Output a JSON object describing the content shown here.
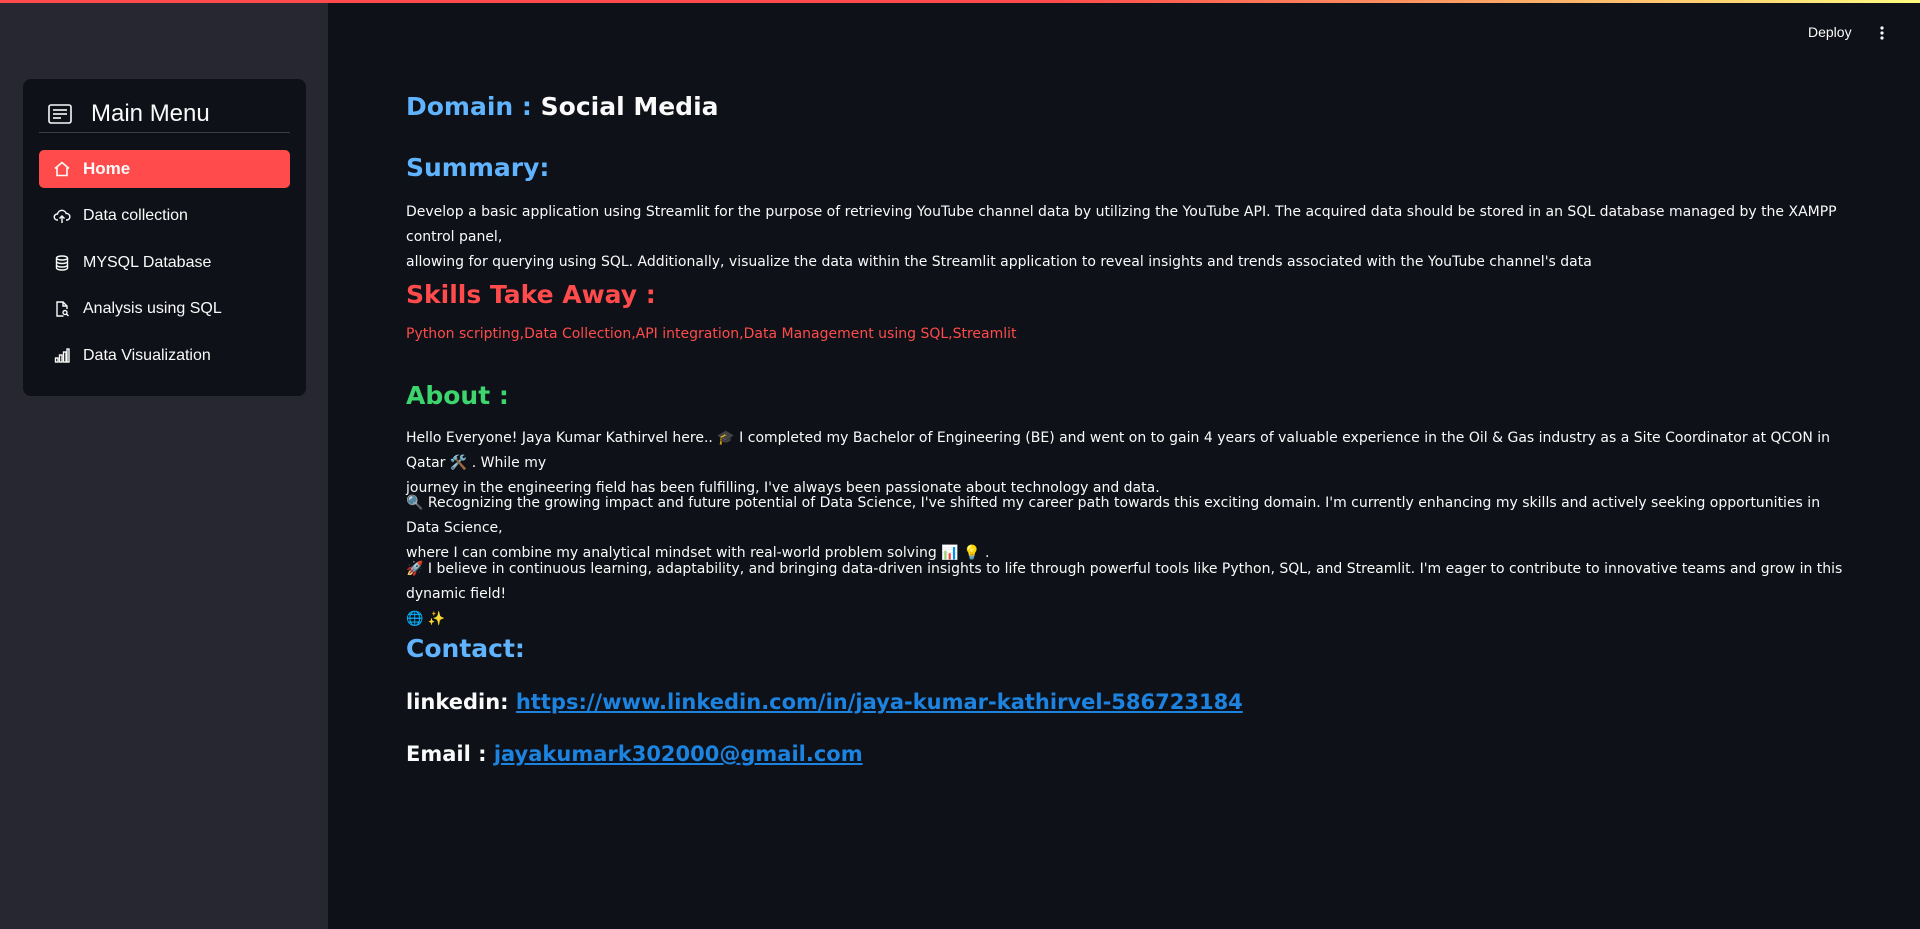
{
  "colors": {
    "accent": "#ff4b4b",
    "heading_blue": "#60b4ff",
    "about_green": "#3dd56d",
    "link": "#1c83e1",
    "background": "#0e1117",
    "sidebar": "#262730"
  },
  "header": {
    "deploy_label": "Deploy",
    "menu_icon": "vertical-dots-icon"
  },
  "sidebar": {
    "title": "Main Menu",
    "title_icon": "menu-card-icon",
    "items": [
      {
        "label": "Home",
        "icon": "home-icon",
        "active": true
      },
      {
        "label": "Data collection",
        "icon": "cloud-upload-icon",
        "active": false
      },
      {
        "label": "MYSQL Database",
        "icon": "database-icon",
        "active": false
      },
      {
        "label": "Analysis using SQL",
        "icon": "file-search-icon",
        "active": false
      },
      {
        "label": "Data Visualization",
        "icon": "bar-chart-icon",
        "active": false
      }
    ]
  },
  "main": {
    "domain_label": "Domain :",
    "domain_value": "Social Media",
    "summary_heading": "Summary:",
    "summary_text_1": "Develop a basic application using Streamlit for the purpose of retrieving YouTube channel data by utilizing the YouTube API. The acquired data should be stored in an SQL database managed by the XAMPP control panel,",
    "summary_text_2": "allowing for querying using SQL. Additionally, visualize the data within the Streamlit application to reveal insights and trends associated with the YouTube channel's data",
    "skills_heading": "Skills Take Away :",
    "skills_text": "Python scripting,Data Collection,API integration,Data Management using SQL,Streamlit",
    "about_heading": "About :",
    "about_p1_line1": "Hello Everyone! Jaya Kumar Kathirvel here.. 🎓 I completed my Bachelor of Engineering (BE) and went on to gain 4 years of valuable experience in the Oil & Gas industry as a Site Coordinator at QCON in Qatar 🛠️ . While my",
    "about_p1_line2": "journey in the engineering field has been fulfilling, I've always been passionate about technology and data.",
    "about_p2_line1": "🔍 Recognizing the growing impact and future potential of Data Science, I've shifted my career path towards this exciting domain. I'm currently enhancing my skills and actively seeking opportunities in Data Science,",
    "about_p2_line2": "where I can combine my analytical mindset with real-world problem solving 📊 💡 .",
    "about_p3_line1": "🚀 I believe in continuous learning, adaptability, and bringing data-driven insights to life through powerful tools like Python, SQL, and Streamlit. I'm eager to contribute to innovative teams and grow in this dynamic field!",
    "about_p3_line2": "🌐 ✨",
    "contact_heading": "Contact:",
    "linkedin_label": "linkedin:",
    "linkedin_url": "https://www.linkedin.com/in/jaya-kumar-kathirvel-586723184",
    "email_label": "Email :",
    "email_value": "jayakumark302000@gmail.com"
  }
}
